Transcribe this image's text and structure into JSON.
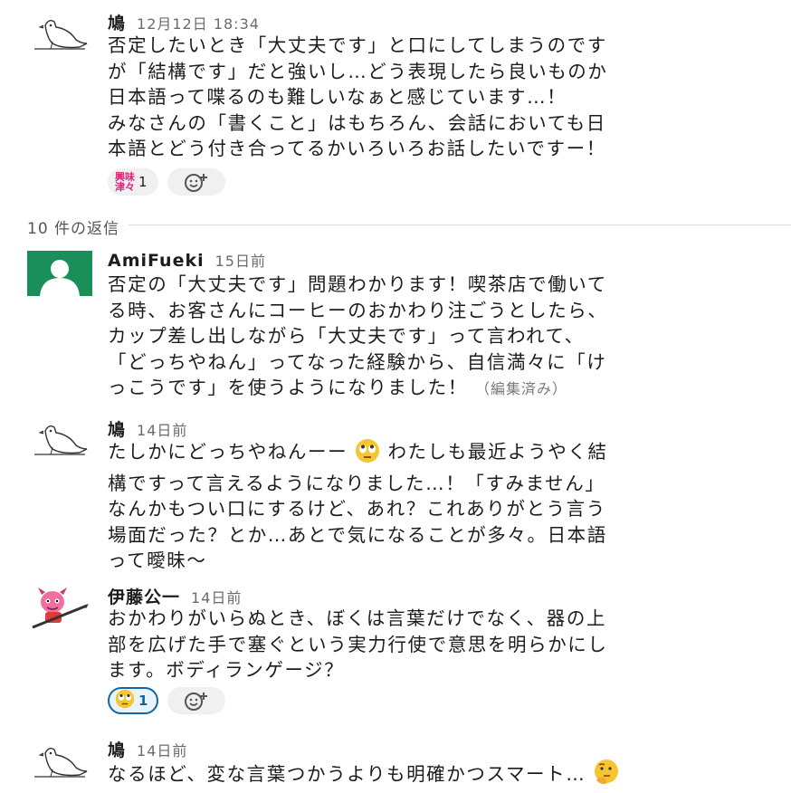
{
  "thread": {
    "parent": {
      "author": "鳩",
      "time": "12月12日 18:34",
      "body": "否定したいとき「大丈夫です」と口にしてしまうのです\nが「結構です」だと強いし…どう表現したら良いものか\n日本語って喋るのも難しいなぁと感じています…！\nみなさんの「書くこと」はもちろん、会話においても日\n本語とどう付き合ってるかいろいろお話したいですー！",
      "reaction_emoji_text_1": "興味",
      "reaction_emoji_text_2": "津々",
      "reaction_count": "1"
    },
    "reply_count_label": "10 件の返信",
    "replies": [
      {
        "author": "AmiFueki",
        "time": "15日前",
        "body": "否定の「大丈夫です」問題わかります！喫茶店で働いて\nる時、お客さんにコーヒーのおかわり注ごうとしたら、\nカップ差し出しながら「大丈夫です」って言われて、\n「どっちやねん」ってなった経験から、自信満々に「け\nっこうです」を使うようになりました！",
        "edited": "（編集済み）"
      },
      {
        "author": "鳩",
        "time": "14日前",
        "line1_a": "たしかにどっちやねんーー",
        "line1_b": "わたしも最近ようやく結",
        "body_rest": "構ですって言えるようになりました…！「すみません」\nなんかもつい口にするけど、あれ？これありがとう言う\n場面だった？とか…あとで気になることが多々。日本語\nって曖昧〜"
      },
      {
        "author": "伊藤公一",
        "time": "14日前",
        "body": "おかわりがいらぬとき、ぼくは言葉だけでなく、器の上\n部を広げた手で塞ぐという実力行使で意思を明らかにし\nます。ボディランゲージ？",
        "reaction_count": "1"
      },
      {
        "author": "鳩",
        "time": "14日前",
        "body": "なるほど、変な言葉つかうよりも明確かつスマート…"
      }
    ]
  },
  "colors": {
    "accent": "#1264a3",
    "amifueki_avatar": "#1a8f5a",
    "kanji_emoji": "#e0207a"
  },
  "icons": [
    "pigeon-avatar-icon",
    "default-user-avatar-icon",
    "demon-character-avatar-icon",
    "add-reaction-icon",
    "rolling-eyes-emoji-icon",
    "thinking-face-emoji-icon"
  ]
}
